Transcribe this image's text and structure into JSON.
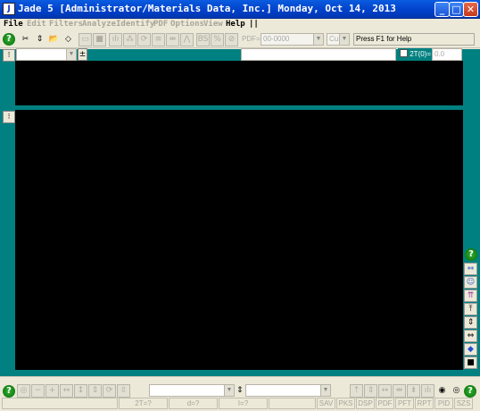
{
  "window": {
    "title": "Jade 5 [Administrator/Materials Data, Inc.] Monday, Oct 14, 2013",
    "app_icon": "J",
    "minimize": "_",
    "maximize": "□",
    "close": "✕"
  },
  "menu": [
    "File",
    "Edit",
    "Filters",
    "Analyze",
    "Identify",
    "PDF",
    "Options",
    "View",
    "Help",
    "||"
  ],
  "toolbar": {
    "pdf_label": "PDF=",
    "pdf_value": "00-0000",
    "radiation": "Cu",
    "hint": "Press F1 for Help"
  },
  "overlay": {
    "two_theta_label": "2T(0)=",
    "two_theta_value": "0.0"
  },
  "statusbar": {
    "two_theta": "2T=?",
    "d": "d=?",
    "intensity": "I=?",
    "panels": [
      "SAV",
      "PKS",
      "DSP",
      "PDF",
      "PFT",
      "RPT",
      "PID",
      "SZS"
    ]
  },
  "icons": {
    "help": "?",
    "expand": "⇔",
    "face": "☺",
    "up_double": "⇈",
    "top": "⤒",
    "updown": "⇕",
    "lr": "⇔",
    "diamond": "◆",
    "stop": "■"
  }
}
